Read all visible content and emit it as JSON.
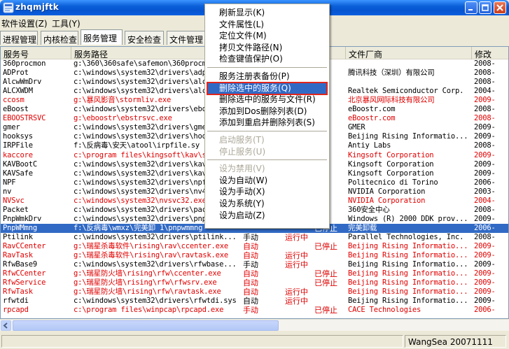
{
  "window": {
    "title": "zhqmjftk"
  },
  "menu": [
    "软件设置(Z)",
    "工具(Y)"
  ],
  "tabs": [
    "进程管理",
    "内核检查",
    "服务管理",
    "安全检查",
    "文件管理"
  ],
  "columns": [
    "服务号",
    "服务路径",
    "",
    "",
    "",
    "文件厂商",
    "修改"
  ],
  "rows": [
    {
      "name": "360procmon",
      "path": "g:\\360\\360safe\\safemon\\360procm",
      "start": "",
      "state": "",
      "stopped": "",
      "vendor": "",
      "mod": "2008-",
      "red": false
    },
    {
      "name": "ADProt",
      "path": "c:\\windows\\system32\\drivers\\adp",
      "start": "",
      "state": "",
      "stopped": "",
      "vendor": "腾讯科技（深圳）有限公司",
      "mod": "2008-",
      "red": false
    },
    {
      "name": "AlcwWmDrv",
      "path": "c:\\windows\\system32\\drivers\\alc",
      "start": "",
      "state": "",
      "stopped": "",
      "vendor": "",
      "mod": "2008-",
      "red": false
    },
    {
      "name": "ALCXWDM",
      "path": "c:\\windows\\system32\\drivers\\alc",
      "start": "",
      "state": "",
      "stopped": "",
      "vendor": "Realtek Semiconductor Corp.",
      "mod": "2004-",
      "red": false
    },
    {
      "name": "ccosm",
      "path": "g:\\暴风影音\\stormliv.exe",
      "start": "",
      "state": "",
      "stopped": "",
      "vendor": "北京暴风网际科技有限公司",
      "mod": "2009-",
      "red": true
    },
    {
      "name": "eBoost",
      "path": "c:\\windows\\system32\\drivers\\ebo",
      "start": "",
      "state": "",
      "stopped": "",
      "vendor": "eBoostr.com",
      "mod": "2008-",
      "red": false
    },
    {
      "name": "EBOOSTRSVC",
      "path": "g:\\eboostr\\ebstrsvc.exe",
      "start": "",
      "state": "",
      "stopped": "",
      "vendor": "eBoostr.com",
      "mod": "2008-",
      "red": true
    },
    {
      "name": "gmer",
      "path": "c:\\windows\\system32\\drivers\\gme",
      "start": "",
      "state": "",
      "stopped": "",
      "vendor": "GMER",
      "mod": "2009-",
      "red": false
    },
    {
      "name": "hooksys",
      "path": "c:\\windows\\system32\\drivers\\hoo",
      "start": "",
      "state": "",
      "stopped": "",
      "vendor": "Beijing Rising Informatio...",
      "mod": "2009-",
      "red": false
    },
    {
      "name": "IRPFile",
      "path": "f:\\反病毒\\安天\\atool\\irpfile.sy",
      "start": "",
      "state": "",
      "stopped": "",
      "vendor": "Antiy Labs",
      "mod": "2008-",
      "red": false
    },
    {
      "name": "kaccore",
      "path": "c:\\program files\\kingsoft\\kav\\s",
      "start": "",
      "state": "",
      "stopped": "",
      "vendor": "Kingsoft Corporation",
      "mod": "2009-",
      "red": true
    },
    {
      "name": "KAVBootC",
      "path": "c:\\windows\\system32\\drivers\\kav",
      "start": "",
      "state": "",
      "stopped": "",
      "vendor": "Kingsoft Corporation",
      "mod": "2009-",
      "red": false
    },
    {
      "name": "KAVSafe",
      "path": "c:\\windows\\system32\\drivers\\kav",
      "start": "",
      "state": "",
      "stopped": "",
      "vendor": "Kingsoft Corporation",
      "mod": "2009-",
      "red": false
    },
    {
      "name": "NPF",
      "path": "c:\\windows\\system32\\drivers\\npf",
      "start": "",
      "state": "",
      "stopped": "",
      "vendor": "Politecnico di Torino",
      "mod": "2006-",
      "red": false
    },
    {
      "name": "nv",
      "path": "c:\\windows\\system32\\drivers\\nv4",
      "start": "",
      "state": "",
      "stopped": "",
      "vendor": "NVIDIA Corporation",
      "mod": "2003-",
      "red": false
    },
    {
      "name": "NVSvc",
      "path": "c:\\windows\\system32\\nvsvc32.exe",
      "start": "",
      "state": "",
      "stopped": "",
      "vendor": "NVIDIA Corporation",
      "mod": "2004-",
      "red": true
    },
    {
      "name": "Packet",
      "path": "c:\\windows\\system32\\drivers\\pac",
      "start": "",
      "state": "",
      "stopped": "",
      "vendor": "360安全中心",
      "mod": "2008-",
      "red": false
    },
    {
      "name": "PnpWmkDrv",
      "path": "c:\\windows\\system32\\drivers\\pnp",
      "start": "",
      "state": "",
      "stopped": "",
      "vendor": "Windows (R) 2000 DDK prov...",
      "mod": "2009-",
      "red": false
    },
    {
      "name": "PnpWMmng",
      "path": "f:\\反病毒\\wmxz\\完美卸 1\\pnpwmmng",
      "start": "",
      "state": "",
      "stopped": "已停止",
      "vendor": "完美卸载",
      "mod": "2006-",
      "red": false,
      "sel": true
    },
    {
      "name": "Ptilink",
      "path": "c:\\windows\\system32\\drivers\\ptilink...",
      "start": "手动",
      "state": "运行中",
      "stopped": "",
      "vendor": "Parallel Technologies, Inc.",
      "mod": "2008-",
      "red": false
    },
    {
      "name": "RavCCenter",
      "path": "g:\\瑞星杀毒软件\\rising\\rav\\ccenter.exe",
      "start": "自动",
      "state": "",
      "stopped": "已停止",
      "vendor": "Beijing Rising Informatio...",
      "mod": "2009-",
      "red": true
    },
    {
      "name": "RavTask",
      "path": "g:\\瑞星杀毒软件\\rising\\rav\\ravtask.exe",
      "start": "自动",
      "state": "运行中",
      "stopped": "",
      "vendor": "Beijing Rising Informatio...",
      "mod": "2009-",
      "red": true
    },
    {
      "name": "RfwBase9",
      "path": "c:\\windows\\system32\\drivers\\rfwbase...",
      "start": "手动",
      "state": "运行中",
      "stopped": "",
      "vendor": "Beijing Rising Informatio...",
      "mod": "2009-",
      "red": false
    },
    {
      "name": "RfwCCenter",
      "path": "g:\\瑞星防火墙\\rising\\rfw\\ccenter.exe",
      "start": "自动",
      "state": "",
      "stopped": "已停止",
      "vendor": "Beijing Rising Informatio...",
      "mod": "2009-",
      "red": true
    },
    {
      "name": "RfwService",
      "path": "g:\\瑞星防火墙\\rising\\rfw\\rfwsrv.exe",
      "start": "自动",
      "state": "",
      "stopped": "已停止",
      "vendor": "Beijing Rising Informatio...",
      "mod": "2009-",
      "red": true
    },
    {
      "name": "RfwTask",
      "path": "g:\\瑞星防火墙\\rising\\rfw\\ravtask.exe",
      "start": "自动",
      "state": "运行中",
      "stopped": "",
      "vendor": "Beijing Rising Informatio...",
      "mod": "2009-",
      "red": true
    },
    {
      "name": "rfwtdi",
      "path": "c:\\windows\\system32\\drivers\\rfwtdi.sys",
      "start": "自动",
      "state": "运行中",
      "stopped": "",
      "vendor": "Beijing Rising Informatio...",
      "mod": "2009-",
      "red": false
    },
    {
      "name": "rpcapd",
      "path": "c:\\program files\\winpcap\\rpcapd.exe",
      "start": "手动",
      "state": "",
      "stopped": "已停止",
      "vendor": "CACE Technologies",
      "mod": "2006-",
      "red": true
    }
  ],
  "context_menu": [
    {
      "label": "刷新显示(K)",
      "disabled": false
    },
    {
      "label": "文件属性(L)",
      "disabled": false
    },
    {
      "label": "定位文件(M)",
      "disabled": false
    },
    {
      "label": "拷贝文件路径(N)",
      "disabled": false
    },
    {
      "label": "检查键值保护(O)",
      "disabled": false
    },
    {
      "sep": true
    },
    {
      "label": "服务注册表备份(P)",
      "disabled": false
    },
    {
      "label": "删除选中的服务(Q)",
      "disabled": false,
      "highlight": true
    },
    {
      "label": "删除选中的服务与文件(R)",
      "disabled": false
    },
    {
      "label": "添加到Dos删除列表(D)",
      "disabled": false
    },
    {
      "label": "添加到重启并删除列表(S)",
      "disabled": false
    },
    {
      "sep": true
    },
    {
      "label": "启动服务(T)",
      "disabled": true
    },
    {
      "label": "停止服务(U)",
      "disabled": true
    },
    {
      "sep": true
    },
    {
      "label": "设为禁用(V)",
      "disabled": true
    },
    {
      "label": "设为自动(W)",
      "disabled": false
    },
    {
      "label": "设为手动(X)",
      "disabled": false
    },
    {
      "label": "设为系统(Y)",
      "disabled": false
    },
    {
      "label": "设为启动(Z)",
      "disabled": false
    }
  ],
  "status": {
    "text": "WangSea 20071111"
  },
  "colors": {
    "accent": "#316ac5",
    "danger": "#e00000",
    "title": "#0a5fd8"
  },
  "icons": [
    "app-icon",
    "minimize-icon",
    "maximize-icon",
    "close-icon",
    "scroll-left-icon"
  ]
}
